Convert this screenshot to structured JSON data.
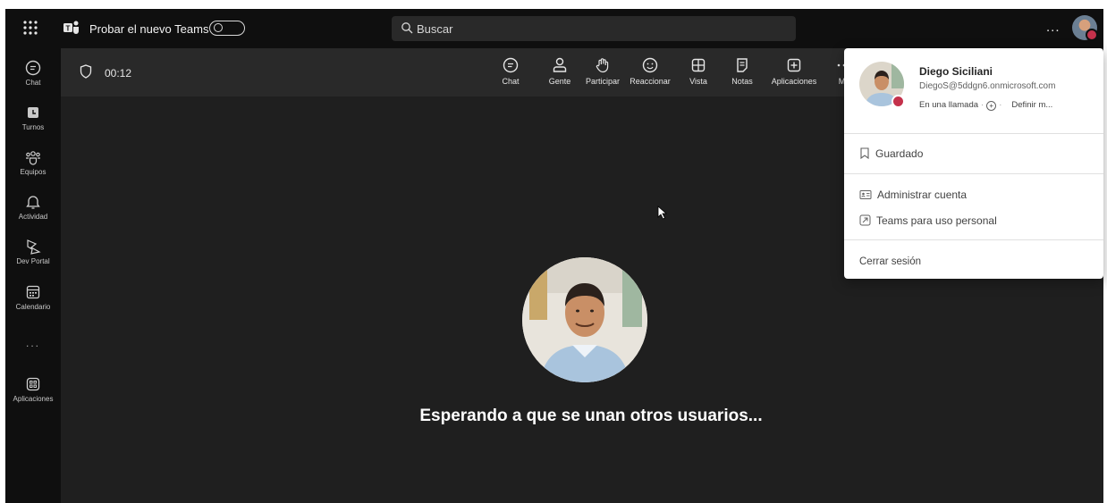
{
  "titlebar": {
    "try_new_teams": "Probar el nuevo Teams",
    "search_placeholder": "Buscar",
    "more": "..."
  },
  "rail": {
    "items": [
      {
        "label": "Chat",
        "icon": "chat-icon"
      },
      {
        "label": "Turnos",
        "icon": "shifts-icon"
      },
      {
        "label": "Equipos",
        "icon": "teams-icon"
      },
      {
        "label": "Actividad",
        "icon": "bell-icon"
      },
      {
        "label": "Dev Portal",
        "icon": "dev-portal-icon"
      },
      {
        "label": "Calendario",
        "icon": "calendar-icon"
      },
      {
        "label": "Aplicaciones",
        "icon": "apps-icon"
      }
    ],
    "more": "..."
  },
  "meeting": {
    "timer": "00:12",
    "tools": [
      {
        "label": "Chat",
        "icon": "chat-icon"
      },
      {
        "label": "Gente",
        "icon": "people-icon"
      },
      {
        "label": "Participar",
        "icon": "raise-hand-icon"
      },
      {
        "label": "Reaccionar",
        "icon": "emoji-icon"
      },
      {
        "label": "Vista",
        "icon": "grid-view-icon"
      },
      {
        "label": "Notas",
        "icon": "notes-icon"
      },
      {
        "label": "Aplicaciones",
        "icon": "add-app-icon"
      },
      {
        "label": "Má",
        "icon": "more-icon"
      }
    ],
    "waiting_text": "Esperando a que se unan otros usuarios..."
  },
  "profile": {
    "name": "Diego Siciliani",
    "email": "DiegoS@5ddgn6.onmicrosoft.com",
    "status": "En una llamada",
    "set_message": "Definir m...",
    "status_color": "#c4314b",
    "menu": {
      "saved": "Guardado",
      "manage_account": "Administrar cuenta",
      "personal": "Teams para uso personal",
      "sign_out": "Cerrar sesión"
    }
  }
}
